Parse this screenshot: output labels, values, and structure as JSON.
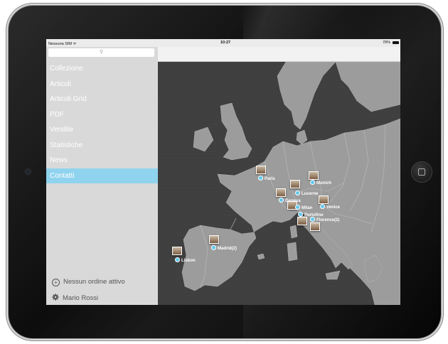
{
  "status_bar": {
    "carrier": "Nessuna SIM ᯤ",
    "time": "10:27",
    "battery": "78%"
  },
  "sidebar": {
    "search_icon": "search-icon",
    "menu": [
      {
        "label": "Collezione"
      },
      {
        "label": "Articoli"
      },
      {
        "label": "Articoli Grid"
      },
      {
        "label": "PDF"
      },
      {
        "label": "Vendite"
      },
      {
        "label": "Statistiche"
      },
      {
        "label": "News"
      },
      {
        "label": "Contatti",
        "active": true
      }
    ],
    "order_status": "Nessun ordine attivo",
    "user_name": "Mario Rossi"
  },
  "map": {
    "cities": [
      {
        "name": "Paris"
      },
      {
        "name": "Munich"
      },
      {
        "name": "Lucerne"
      },
      {
        "name": "Geneva"
      },
      {
        "name": "Milan"
      },
      {
        "name": "Venice"
      },
      {
        "name": "Portofino"
      },
      {
        "name": "Florence(2)"
      },
      {
        "name": "Madrid(2)"
      },
      {
        "name": "Lisbon"
      }
    ]
  },
  "colors": {
    "accent": "#8fd3ee",
    "marker": "#5fc8ee",
    "sea": "#3c3c3c",
    "land": "#9a9a9a"
  }
}
